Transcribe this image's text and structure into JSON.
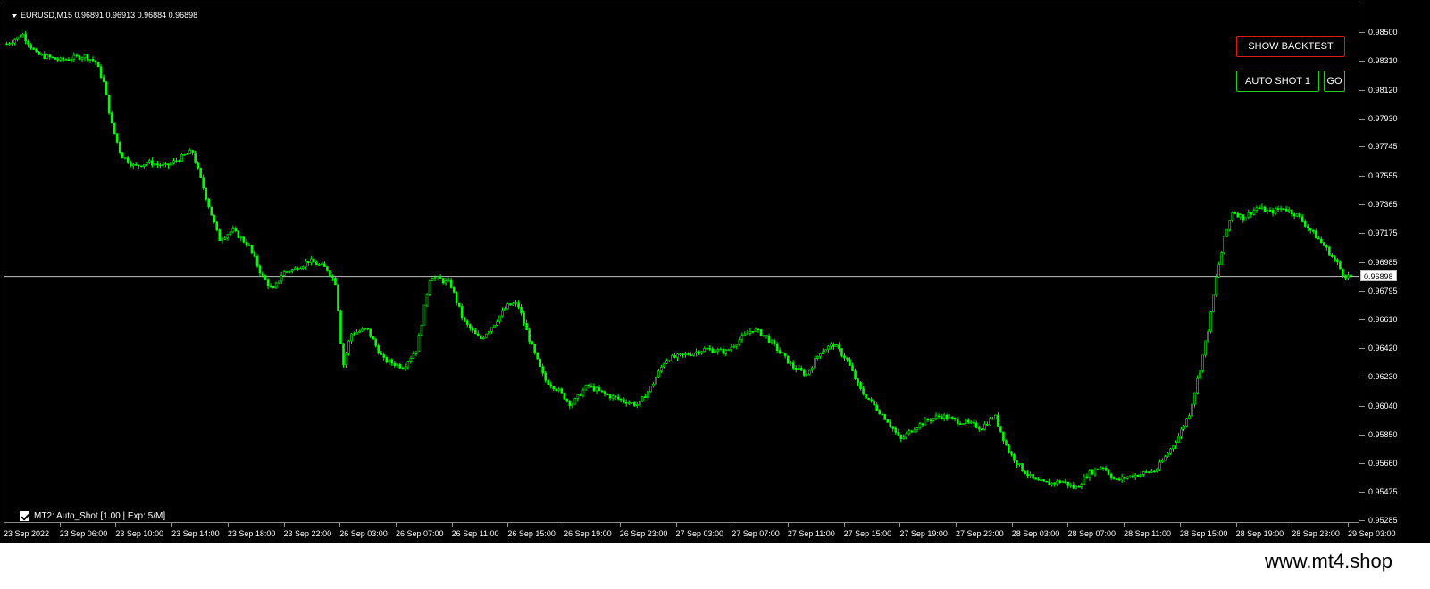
{
  "header": {
    "symbol_info": "EURUSD,M15  0.96891 0.96913 0.96884 0.96898"
  },
  "buttons": {
    "backtest_label": "SHOW BACKTEST",
    "autoshot_label": "AUTO SHOT 1",
    "go_label": "GO"
  },
  "expert": {
    "label": "MT2: Auto_Shot [1.00 | Exp: 5/M]"
  },
  "watermark": "www.mt4.shop",
  "colors": {
    "candle": "#00ff00",
    "background": "#000000",
    "grid_line": "#bfbfbf",
    "backtest_border": "#e01919",
    "autoshot_border": "#1fcf1f"
  },
  "chart_data": {
    "type": "candlestick",
    "current_price": 0.96898,
    "price_labels": [
      "0.98500",
      "0.98310",
      "0.98120",
      "0.97930",
      "0.97745",
      "0.97555",
      "0.97365",
      "0.97175",
      "0.96985",
      "0.96795",
      "0.96610",
      "0.96420",
      "0.96230",
      "0.96040",
      "0.95850",
      "0.95660",
      "0.95475",
      "0.95285"
    ],
    "ylim": [
      0.95285,
      0.985
    ],
    "time_labels": [
      "23 Sep 2022",
      "23 Sep 06:00",
      "23 Sep 10:00",
      "23 Sep 14:00",
      "23 Sep 18:00",
      "23 Sep 22:00",
      "26 Sep 03:00",
      "26 Sep 07:00",
      "26 Sep 11:00",
      "26 Sep 15:00",
      "26 Sep 19:00",
      "26 Sep 23:00",
      "27 Sep 03:00",
      "27 Sep 07:00",
      "27 Sep 11:00",
      "27 Sep 15:00",
      "27 Sep 19:00",
      "27 Sep 23:00",
      "28 Sep 03:00",
      "28 Sep 07:00",
      "28 Sep 11:00",
      "28 Sep 15:00",
      "28 Sep 19:00",
      "28 Sep 23:00",
      "29 Sep 03:00"
    ],
    "close_path": [
      [
        0,
        0.9843
      ],
      [
        0.012,
        0.9849
      ],
      [
        0.022,
        0.9836
      ],
      [
        0.04,
        0.9832
      ],
      [
        0.058,
        0.9835
      ],
      [
        0.066,
        0.9831
      ],
      [
        0.072,
        0.9818
      ],
      [
        0.078,
        0.979
      ],
      [
        0.085,
        0.977
      ],
      [
        0.095,
        0.9762
      ],
      [
        0.105,
        0.9765
      ],
      [
        0.118,
        0.9762
      ],
      [
        0.13,
        0.9768
      ],
      [
        0.138,
        0.9772
      ],
      [
        0.148,
        0.9743
      ],
      [
        0.158,
        0.9714
      ],
      [
        0.168,
        0.972
      ],
      [
        0.18,
        0.971
      ],
      [
        0.19,
        0.969
      ],
      [
        0.198,
        0.968
      ],
      [
        0.205,
        0.9692
      ],
      [
        0.215,
        0.9695
      ],
      [
        0.225,
        0.97
      ],
      [
        0.238,
        0.9695
      ],
      [
        0.245,
        0.9685
      ],
      [
        0.25,
        0.963
      ],
      [
        0.256,
        0.9652
      ],
      [
        0.268,
        0.9655
      ],
      [
        0.28,
        0.9635
      ],
      [
        0.295,
        0.963
      ],
      [
        0.305,
        0.9642
      ],
      [
        0.315,
        0.969
      ],
      [
        0.33,
        0.9685
      ],
      [
        0.34,
        0.966
      ],
      [
        0.352,
        0.9648
      ],
      [
        0.362,
        0.9658
      ],
      [
        0.372,
        0.967
      ],
      [
        0.38,
        0.9672
      ],
      [
        0.39,
        0.9645
      ],
      [
        0.4,
        0.9622
      ],
      [
        0.41,
        0.9615
      ],
      [
        0.42,
        0.9605
      ],
      [
        0.432,
        0.9618
      ],
      [
        0.445,
        0.9612
      ],
      [
        0.458,
        0.9608
      ],
      [
        0.47,
        0.9605
      ],
      [
        0.48,
        0.9618
      ],
      [
        0.49,
        0.9635
      ],
      [
        0.505,
        0.9638
      ],
      [
        0.52,
        0.9642
      ],
      [
        0.535,
        0.964
      ],
      [
        0.545,
        0.9648
      ],
      [
        0.555,
        0.9655
      ],
      [
        0.565,
        0.965
      ],
      [
        0.575,
        0.964
      ],
      [
        0.585,
        0.963
      ],
      [
        0.595,
        0.9625
      ],
      [
        0.605,
        0.964
      ],
      [
        0.615,
        0.9645
      ],
      [
        0.625,
        0.9635
      ],
      [
        0.635,
        0.9615
      ],
      [
        0.645,
        0.9605
      ],
      [
        0.655,
        0.9595
      ],
      [
        0.665,
        0.9582
      ],
      [
        0.675,
        0.959
      ],
      [
        0.685,
        0.9595
      ],
      [
        0.695,
        0.9598
      ],
      [
        0.705,
        0.9595
      ],
      [
        0.715,
        0.9593
      ],
      [
        0.725,
        0.959
      ],
      [
        0.735,
        0.9598
      ],
      [
        0.745,
        0.9575
      ],
      [
        0.755,
        0.9563
      ],
      [
        0.765,
        0.9555
      ],
      [
        0.775,
        0.9553
      ],
      [
        0.785,
        0.9555
      ],
      [
        0.795,
        0.955
      ],
      [
        0.805,
        0.956
      ],
      [
        0.815,
        0.9565
      ],
      [
        0.825,
        0.9555
      ],
      [
        0.835,
        0.9558
      ],
      [
        0.845,
        0.956
      ],
      [
        0.855,
        0.9562
      ],
      [
        0.865,
        0.9575
      ],
      [
        0.872,
        0.9585
      ],
      [
        0.88,
        0.96
      ],
      [
        0.888,
        0.963
      ],
      [
        0.895,
        0.966
      ],
      [
        0.9,
        0.969
      ],
      [
        0.906,
        0.9715
      ],
      [
        0.912,
        0.9733
      ],
      [
        0.92,
        0.9728
      ],
      [
        0.93,
        0.9735
      ],
      [
        0.94,
        0.9732
      ],
      [
        0.95,
        0.9735
      ],
      [
        0.96,
        0.973
      ],
      [
        0.97,
        0.972
      ],
      [
        0.98,
        0.971
      ],
      [
        0.99,
        0.9698
      ],
      [
        0.995,
        0.969
      ]
    ]
  }
}
